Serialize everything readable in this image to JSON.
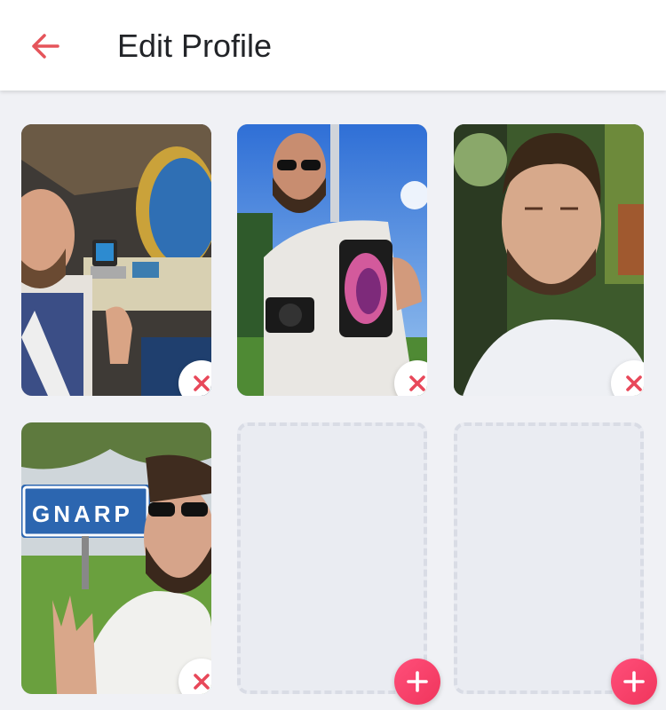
{
  "header": {
    "title": "Edit Profile",
    "back_icon": "arrow-left-icon",
    "back_color": "#e5545a"
  },
  "photos": [
    {
      "slot": 1,
      "description_icon": "photo",
      "remove_icon": "close-icon"
    },
    {
      "slot": 2,
      "description_icon": "photo",
      "remove_icon": "close-icon"
    },
    {
      "slot": 3,
      "description_icon": "photo",
      "remove_icon": "close-icon"
    },
    {
      "slot": 4,
      "description_icon": "photo",
      "remove_icon": "close-icon",
      "sign_text": "GNARP"
    }
  ],
  "empty_slots": [
    {
      "slot": 5,
      "add_icon": "plus-icon"
    },
    {
      "slot": 6,
      "add_icon": "plus-icon"
    }
  ],
  "colors": {
    "accent": "#f0355c",
    "remove_x": "#e8485a",
    "background": "#f0f1f5",
    "empty_tile": "#eaecf2"
  }
}
